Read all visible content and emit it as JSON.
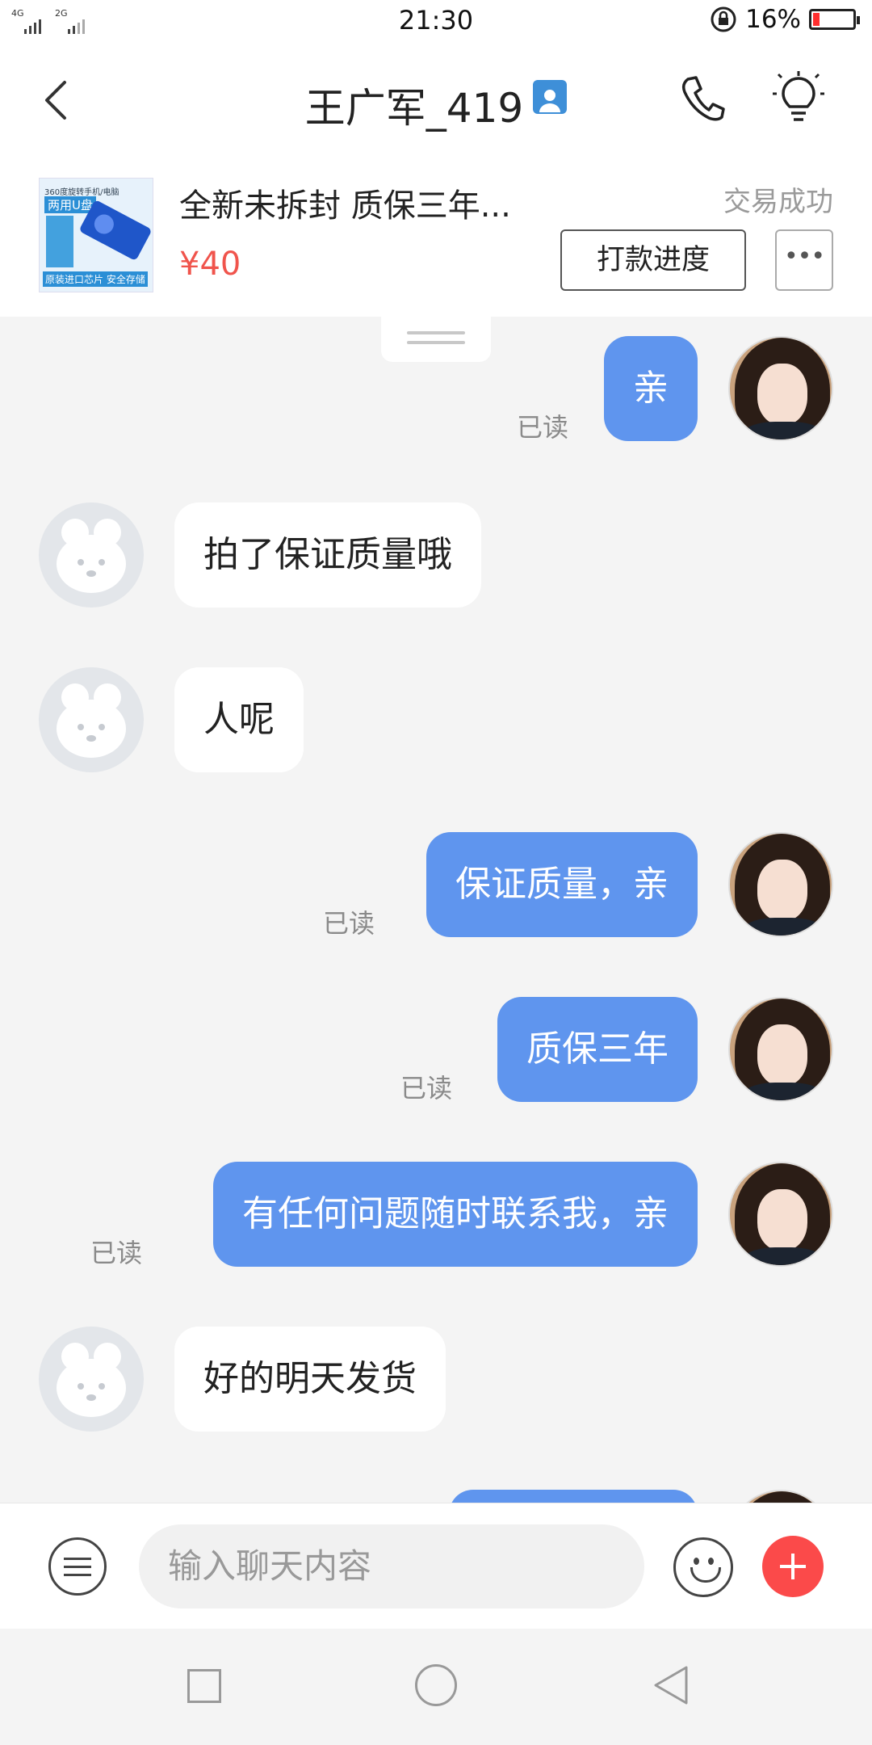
{
  "status_bar": {
    "network_1": "4G",
    "network_2": "2G",
    "time": "21:30",
    "battery_percent": "16%",
    "battery_level": 0.16,
    "battery_color": "#ff2f2f"
  },
  "header": {
    "back_icon": "back-chevron-icon",
    "title": "王广军_419",
    "title_badge_icon": "user-profile-icon",
    "call_icon": "phone-icon",
    "tips_icon": "lightbulb-icon"
  },
  "product": {
    "thumb_text_small": "360度旋转手机/电脑",
    "thumb_text_big": "两用U盘",
    "thumb_text_bottom": "原装进口芯片  安全存储",
    "title": "全新未拆封  质保三年...",
    "price": "¥40",
    "status": "交易成功",
    "pay_progress_label": "打款进度",
    "more_label": "•••"
  },
  "messages": [
    {
      "side": "out",
      "text": "亲",
      "read": "已读"
    },
    {
      "side": "in",
      "text": "拍了保证质量哦"
    },
    {
      "side": "in",
      "text": "人呢"
    },
    {
      "side": "out",
      "text": "保证质量，亲",
      "read": "已读"
    },
    {
      "side": "out",
      "text": "质保三年",
      "read": "已读"
    },
    {
      "side": "out",
      "text": "有任何问题随时联系我，亲",
      "read": "已读"
    },
    {
      "side": "in",
      "text": "好的明天发货"
    }
  ],
  "input_bar": {
    "menu_icon": "menu-icon",
    "placeholder": "输入聊天内容",
    "emoji_icon": "emoji-icon",
    "plus_icon": "plus-icon"
  },
  "system_nav": {
    "recent_icon": "square-icon",
    "home_icon": "circle-icon",
    "back_icon": "triangle-back-icon"
  },
  "colors": {
    "accent_bubble": "#5f95ee",
    "price": "#f0544c",
    "plus_button": "#fb4a4a"
  }
}
